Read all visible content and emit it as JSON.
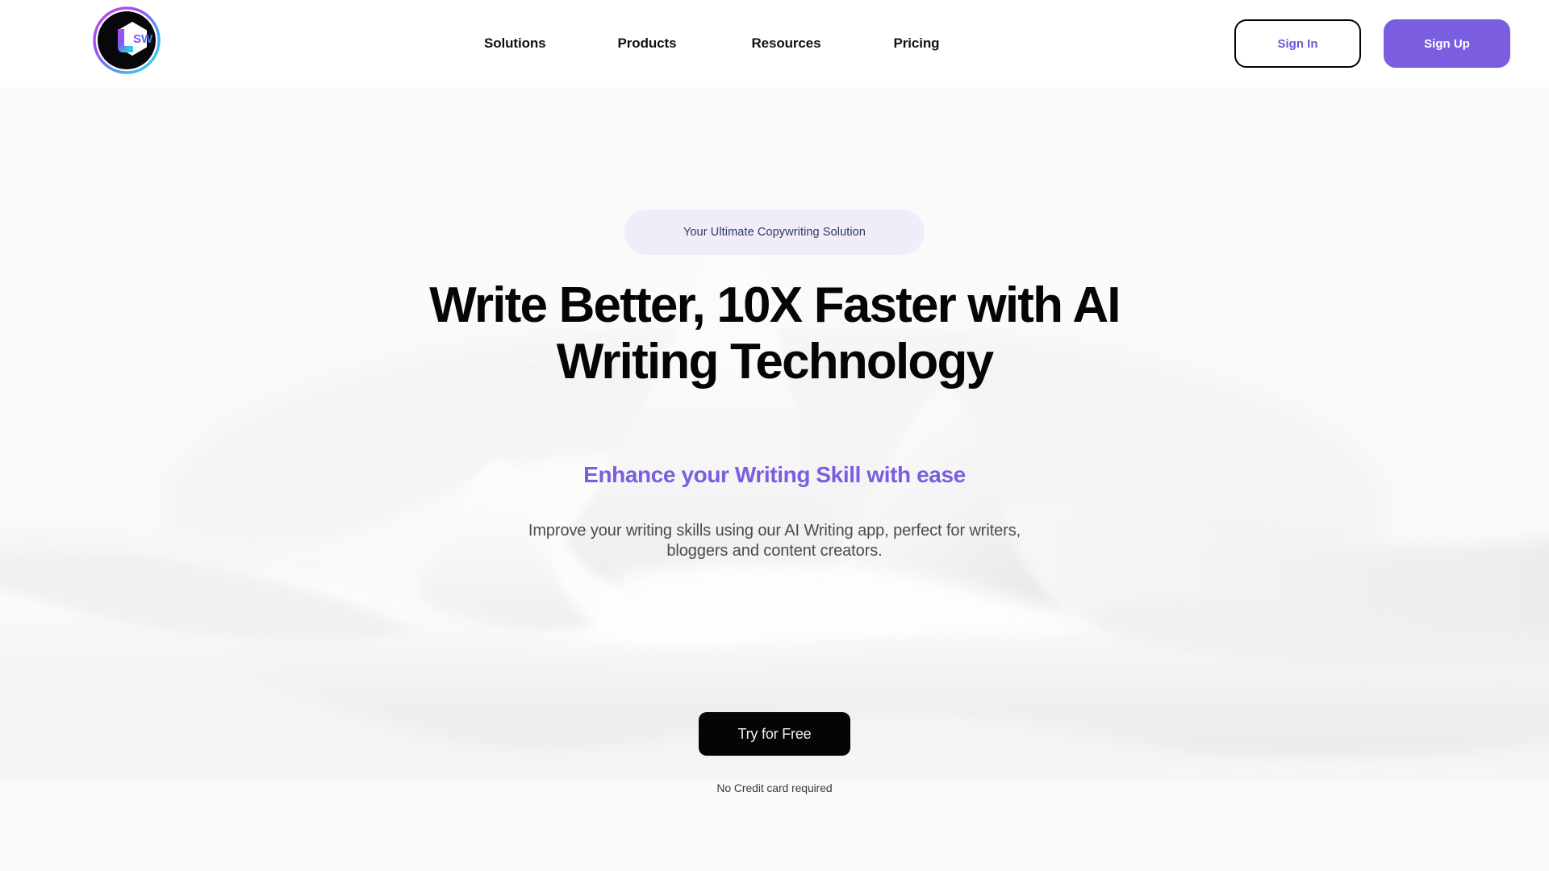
{
  "brand": {
    "logo_icon": "sw-hexagon-logo-icon",
    "logo_text": "SW"
  },
  "header": {
    "nav": [
      {
        "label": "Solutions"
      },
      {
        "label": "Products"
      },
      {
        "label": "Resources"
      },
      {
        "label": "Pricing"
      }
    ],
    "sign_in_label": "Sign In",
    "sign_up_label": "Sign Up"
  },
  "hero": {
    "badge_label": "Your Ultimate Copywriting Solution",
    "headline": "Write Better, 10X Faster with AI Writing Technology",
    "subheadline": "Enhance your Writing Skill with ease",
    "paragraph": "Improve your writing skills using our AI Writing app, perfect for writers, bloggers and content creators.",
    "cta_label": "Try for Free",
    "cta_note": "No Credit card required"
  },
  "colors": {
    "accent_purple": "#7b5de0",
    "sign_in_text": "#6f55d3",
    "badge_bg": "#f0edf9",
    "badge_text": "#2c3a66",
    "headline": "#050505",
    "paragraph": "#4b4b4b",
    "cta_bg": "#050505",
    "header_bg": "#ffffff",
    "hero_bg": "#fafafa",
    "logo_gradient_start": "#b14ae8",
    "logo_gradient_end": "#2fd8ef"
  }
}
